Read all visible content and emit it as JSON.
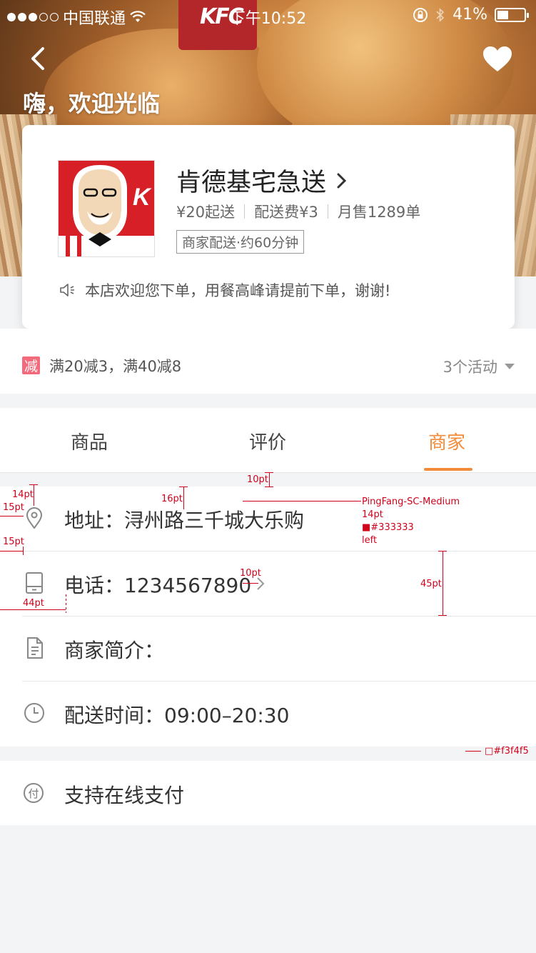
{
  "status": {
    "carrier": "中国联通",
    "time": "下午10:52",
    "battery": "41%",
    "battery_level": 0.41
  },
  "hero": {
    "cup_text": "KFC",
    "welcome": "嗨，欢迎光临"
  },
  "store": {
    "name": "肯德基宅急送",
    "min_order": "¥20起送",
    "delivery_fee": "配送费¥3",
    "monthly_sales": "月售1289单",
    "delivery_tag": "商家配送·约60分钟",
    "notice": "本店欢迎您下单，用餐高峰请提前下单，谢谢!"
  },
  "promo": {
    "badge": "减",
    "text": "满20减3，满40减8",
    "more": "3个活动"
  },
  "tabs": [
    {
      "label": "商品"
    },
    {
      "label": "评价"
    },
    {
      "label": "商家"
    }
  ],
  "info": {
    "address": "地址：浔州路三千城大乐购",
    "phone": "电话：1234567890",
    "intro": "商家简介：",
    "hours": "配送时间：09:00–20:30",
    "payment": "支持在线支付",
    "payment_icon": "付"
  },
  "annotations": {
    "gap_top": "10pt",
    "icon_top": "14pt",
    "text_top": "16pt",
    "left_pad": "15pt",
    "left_pad2": "15pt",
    "font_name": "PingFang-SC-Medium",
    "font_size": "14pt",
    "font_color": "■#333333",
    "align": "left",
    "arrow_gap": "10pt",
    "text_left": "44pt",
    "row_height": "45pt",
    "bg_color": "□#f3f4f5"
  },
  "colors": {
    "accent": "#f28c3a",
    "promo_badge": "#f36a7c",
    "text": "#333333",
    "background": "#f3f4f5",
    "annotation": "#d0021b"
  }
}
